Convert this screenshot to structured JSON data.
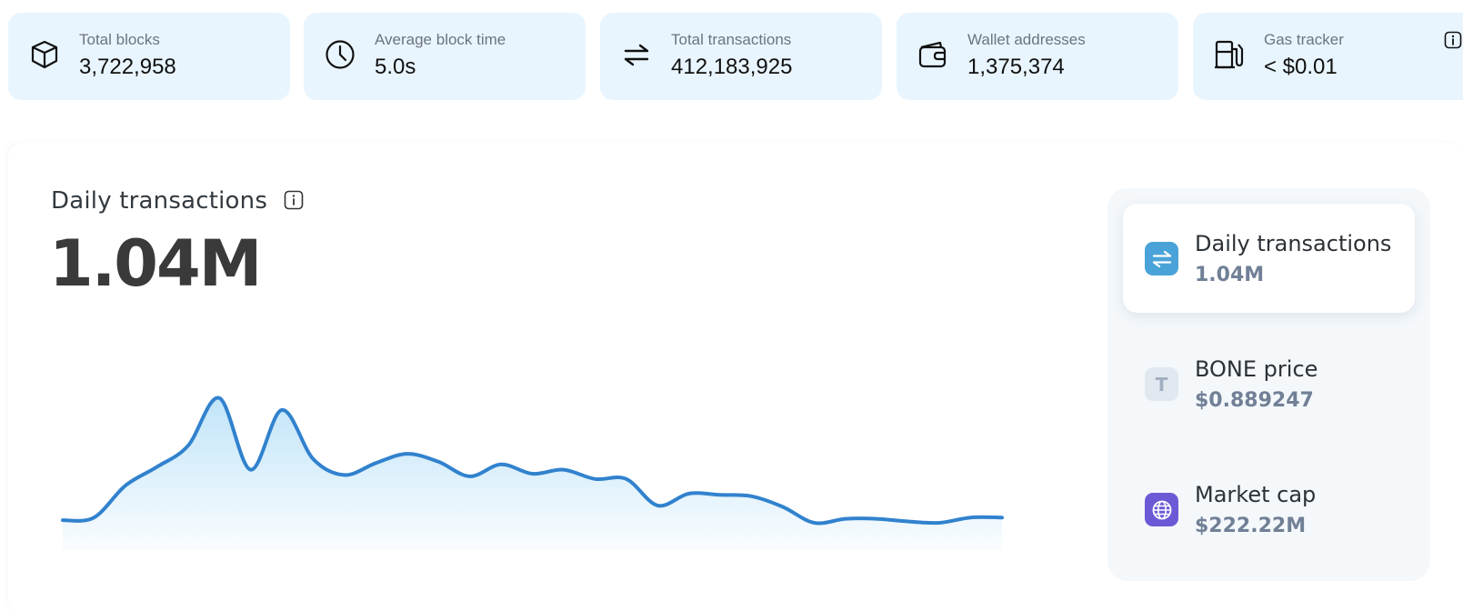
{
  "stats": [
    {
      "icon": "cube-icon",
      "label": "Total blocks",
      "value": "3,722,958"
    },
    {
      "icon": "clock-icon",
      "label": "Average block time",
      "value": "5.0s"
    },
    {
      "icon": "swap-arrows-icon",
      "label": "Total transactions",
      "value": "412,183,925"
    },
    {
      "icon": "wallet-icon",
      "label": "Wallet addresses",
      "value": "1,375,374"
    },
    {
      "icon": "gas-pump-icon",
      "label": "Gas tracker",
      "value": "< $0.01"
    }
  ],
  "main_chart": {
    "title": "Daily transactions",
    "big_value": "1.04M"
  },
  "side_panel": {
    "items": [
      {
        "icon": "swap-arrows-icon",
        "title": "Daily transactions",
        "value": "1.04M",
        "icon_color": "#4aa3d8",
        "active": true
      },
      {
        "icon": "token-t-icon",
        "icon_text": "T",
        "title": "BONE price",
        "value": "$0.889247",
        "icon_color": "#e2e8f0",
        "active": false
      },
      {
        "icon": "globe-icon",
        "title": "Market cap",
        "value": "$222.22M",
        "icon_color": "#6b5ad6",
        "active": false
      }
    ]
  },
  "colors": {
    "card_bg": "#e9f5fe",
    "line": "#3182ce",
    "area_top": "#bee3f8"
  },
  "chart_data": {
    "type": "area",
    "title": "Daily transactions",
    "xlabel": "",
    "ylabel": "",
    "grid": false,
    "y": [
      0.02,
      0.04,
      0.28,
      0.42,
      0.58,
      0.94,
      0.4,
      0.85,
      0.48,
      0.36,
      0.45,
      0.52,
      0.46,
      0.35,
      0.44,
      0.37,
      0.4,
      0.33,
      0.33,
      0.13,
      0.22,
      0.21,
      0.2,
      0.12,
      0.0,
      0.03,
      0.03,
      0.01,
      0.0,
      0.04,
      0.04
    ]
  }
}
